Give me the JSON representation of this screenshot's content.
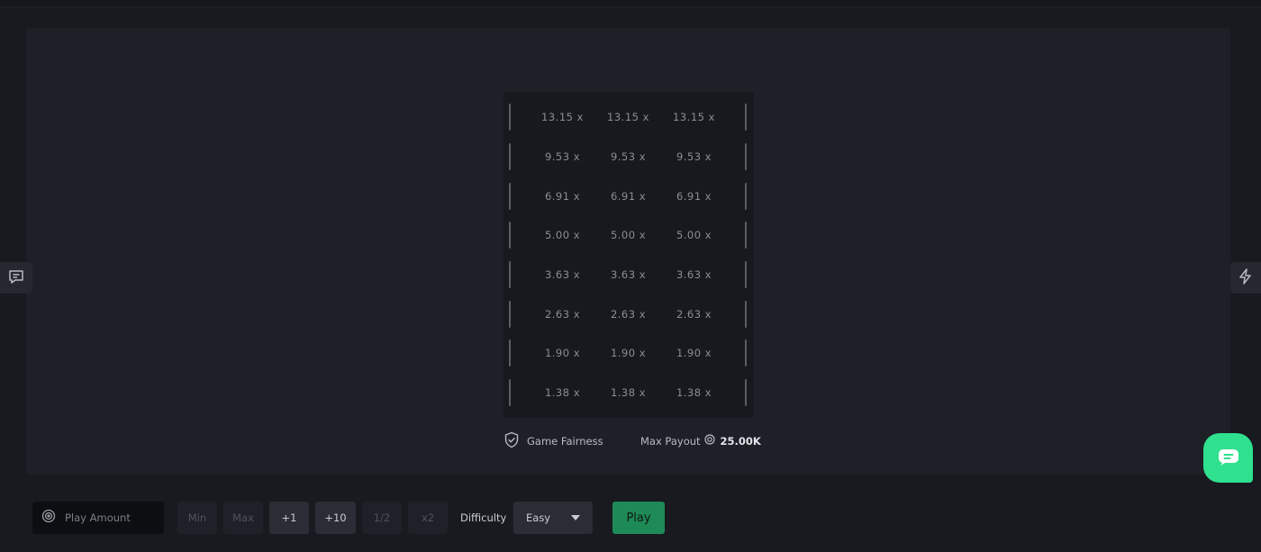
{
  "board": {
    "rows": [
      [
        "13.15 x",
        "13.15 x",
        "13.15 x"
      ],
      [
        "9.53 x",
        "9.53 x",
        "9.53 x"
      ],
      [
        "6.91 x",
        "6.91 x",
        "6.91 x"
      ],
      [
        "5.00 x",
        "5.00 x",
        "5.00 x"
      ],
      [
        "3.63 x",
        "3.63 x",
        "3.63 x"
      ],
      [
        "2.63 x",
        "2.63 x",
        "2.63 x"
      ],
      [
        "1.90 x",
        "1.90 x",
        "1.90 x"
      ],
      [
        "1.38 x",
        "1.38 x",
        "1.38 x"
      ]
    ]
  },
  "footer": {
    "fairness_label": "Game Fairness",
    "max_payout_label": "Max Payout",
    "max_payout_value": "25.00K"
  },
  "controls": {
    "amount_placeholder": "Play Amount",
    "min_label": "Min",
    "max_label": "Max",
    "plus1_label": "+1",
    "plus10_label": "+10",
    "half_label": "1/2",
    "double_label": "x2",
    "difficulty_label": "Difficulty",
    "difficulty_value": "Easy",
    "play_label": "Play"
  },
  "colors": {
    "accent": "#2fe08f",
    "play_button": "#1e8a55",
    "background": "#181a20",
    "panel": "#1e2028"
  }
}
